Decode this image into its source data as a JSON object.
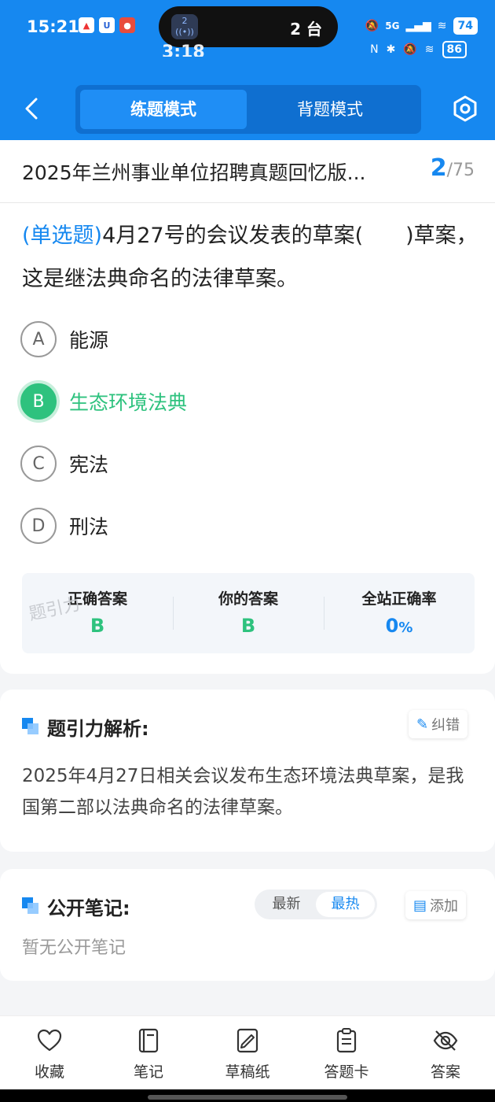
{
  "status_bar": {
    "time": "15:21",
    "island_badge": "2",
    "island_text": "2 台",
    "ghost_time": "3:18",
    "network": "5G",
    "battery": "74",
    "battery_secondary": "86"
  },
  "header": {
    "tabs": [
      {
        "label": "练题模式",
        "active": true
      },
      {
        "label": "背题模式",
        "active": false
      }
    ]
  },
  "title_bar": {
    "title": "2025年兰州事业单位招聘真题回忆版...",
    "current": "2",
    "total": "/75"
  },
  "question": {
    "type": "(单选题)",
    "text": "4月27号的会议发表的草案(　　)草案，这是继法典命名的法律草案。",
    "options": [
      {
        "letter": "A",
        "text": "能源",
        "selected": false
      },
      {
        "letter": "B",
        "text": "生态环境法典",
        "selected": true
      },
      {
        "letter": "C",
        "text": "宪法",
        "selected": false
      },
      {
        "letter": "D",
        "text": "刑法",
        "selected": false
      }
    ]
  },
  "stats": {
    "correct_label": "正确答案",
    "correct_value": "B",
    "yours_label": "你的答案",
    "yours_value": "B",
    "rate_label": "全站正确率",
    "rate_value": "0",
    "rate_unit": "%",
    "watermark": "题引力"
  },
  "analysis": {
    "title": "题引力解析:",
    "correction_label": "纠错",
    "text": "2025年4月27日相关会议发布生态环境法典草案，是我国第二部以法典命名的法律草案。"
  },
  "notes": {
    "title": "公开笔记:",
    "sort_options": [
      {
        "label": "最新",
        "active": false
      },
      {
        "label": "最热",
        "active": true
      }
    ],
    "add_label": "添加",
    "empty_text": "暂无公开笔记"
  },
  "bottom_nav": [
    {
      "label": "收藏",
      "icon": "heart-icon"
    },
    {
      "label": "笔记",
      "icon": "notebook-icon"
    },
    {
      "label": "草稿纸",
      "icon": "draft-paper-icon"
    },
    {
      "label": "答题卡",
      "icon": "answer-card-icon"
    },
    {
      "label": "答案",
      "icon": "eye-off-icon"
    }
  ],
  "colors": {
    "primary": "#1688f0",
    "correct": "#2ec27e"
  }
}
